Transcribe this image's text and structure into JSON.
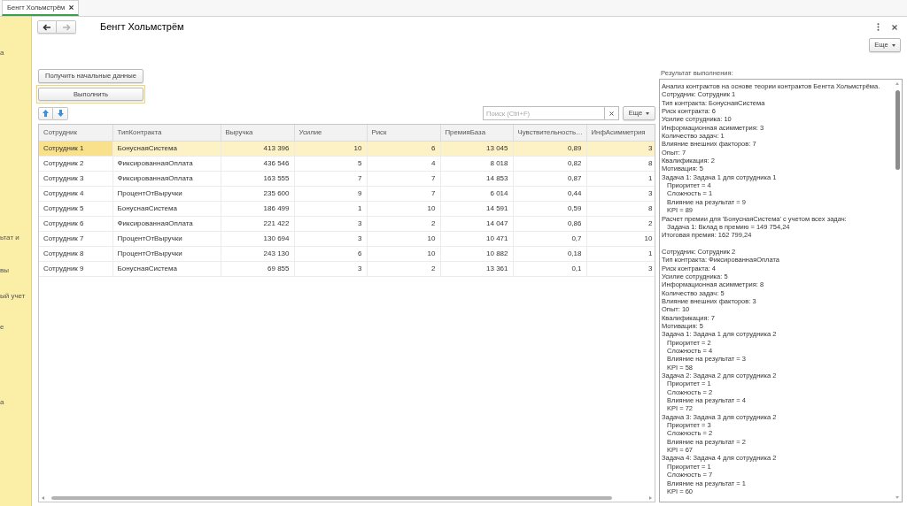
{
  "tab": {
    "title": "Бенгт Хольмстрём",
    "selected": true
  },
  "sidebar": {
    "items": [
      {
        "text": "а"
      },
      {
        "text": "ьтат и"
      },
      {
        "text": "вы"
      },
      {
        "text": "ый учет"
      },
      {
        "text": "е"
      },
      {
        "text": "а"
      }
    ]
  },
  "nav_buttons": [
    {
      "kind": "back",
      "disabled": false
    },
    {
      "kind": "forward",
      "disabled": true
    }
  ],
  "form": {
    "title": "Бенгт Хольмстрём",
    "more_button": "Еще"
  },
  "actions": [
    {
      "label": "Получить начальные данные",
      "focused": false
    },
    {
      "label": "Выполнить",
      "focused": true
    }
  ],
  "table_toolbar": {
    "search": {
      "placeholder": "Поиск (Ctrl+F)"
    },
    "more_button": "Еще"
  },
  "table": {
    "columns": [
      {
        "title": "Сотрудник",
        "kind": "text"
      },
      {
        "title": "ТипКонтракта",
        "kind": "text"
      },
      {
        "title": "Выручка",
        "kind": "number"
      },
      {
        "title": "Усилие",
        "kind": "number"
      },
      {
        "title": "Риск",
        "kind": "number"
      },
      {
        "title": "ПремияБаза",
        "kind": "number"
      },
      {
        "title": "Чувствительность…",
        "kind": "number"
      },
      {
        "title": "ИнфАсимметрия",
        "kind": "number"
      }
    ],
    "rows": [
      {
        "selected": true,
        "cells": [
          "Сотрудник 1",
          "БонуснаяСистема",
          "413 396",
          "10",
          "6",
          "13 045",
          "0,89",
          "3"
        ]
      },
      {
        "selected": false,
        "cells": [
          "Сотрудник 2",
          "ФиксированнаяОплата",
          "436 546",
          "5",
          "4",
          "8 018",
          "0,82",
          "8"
        ]
      },
      {
        "selected": false,
        "cells": [
          "Сотрудник 3",
          "ФиксированнаяОплата",
          "163 555",
          "7",
          "7",
          "14 853",
          "0,87",
          "1"
        ]
      },
      {
        "selected": false,
        "cells": [
          "Сотрудник 4",
          "ПроцентОтВыручки",
          "235 600",
          "9",
          "7",
          "6 014",
          "0,44",
          "3"
        ]
      },
      {
        "selected": false,
        "cells": [
          "Сотрудник 5",
          "БонуснаяСистема",
          "186 499",
          "1",
          "10",
          "14 591",
          "0,59",
          "8"
        ]
      },
      {
        "selected": false,
        "cells": [
          "Сотрудник 6",
          "ФиксированнаяОплата",
          "221 422",
          "3",
          "2",
          "14 047",
          "0,86",
          "2"
        ]
      },
      {
        "selected": false,
        "cells": [
          "Сотрудник 7",
          "ПроцентОтВыручки",
          "130 694",
          "3",
          "10",
          "10 471",
          "0,7",
          "10"
        ]
      },
      {
        "selected": false,
        "cells": [
          "Сотрудник 8",
          "ПроцентОтВыручки",
          "243 130",
          "6",
          "10",
          "10 882",
          "0,18",
          "1"
        ]
      },
      {
        "selected": false,
        "cells": [
          "Сотрудник 9",
          "БонуснаяСистема",
          "69 855",
          "3",
          "2",
          "13 361",
          "0,1",
          "3"
        ]
      }
    ]
  },
  "result": {
    "label": "Результат выполнения:",
    "blocks": [
      {
        "lines": [
          {
            "text": "Анализ контрактов на основе теории контрактов Бенгта Хольмстрёма."
          },
          {
            "text": "Сотрудник: Сотрудник 1"
          },
          {
            "text": "Тип контракта: БонуснаяСистема"
          },
          {
            "text": "Риск контракта: 6"
          },
          {
            "text": "Усилие сотрудника: 10"
          },
          {
            "text": "Информационная асимметрия: 3"
          },
          {
            "text": "Количество задач: 1"
          },
          {
            "text": "Влияние внешних факторов: 7"
          },
          {
            "text": "Опыт: 7"
          },
          {
            "text": "Квалификация: 2"
          },
          {
            "text": "Мотивация: 5"
          },
          {
            "text": "Задача 1: Задача 1 для сотрудника 1",
            "children": [
              "Приоритет = 4",
              "Сложность = 1",
              "Влияние на результат = 9",
              "KPI = 89"
            ]
          },
          {
            "text": "Расчет премии для 'БонуснаяСистема' с учетом всех задач:",
            "children": [
              "Задача 1: Вклад в премию = 149 754,24"
            ]
          },
          {
            "text": "Итоговая премия: 162 799,24"
          }
        ]
      },
      {
        "lines": [
          {
            "text": "Сотрудник: Сотрудник 2"
          },
          {
            "text": "Тип контракта: ФиксированнаяОплата"
          },
          {
            "text": "Риск контракта: 4"
          },
          {
            "text": "Усилие сотрудника: 5"
          },
          {
            "text": "Информационная асимметрия: 8"
          },
          {
            "text": "Количество задач: 5"
          },
          {
            "text": "Влияние внешних факторов: 3"
          },
          {
            "text": "Опыт: 10"
          },
          {
            "text": "Квалификация: 7"
          },
          {
            "text": "Мотивация: 5"
          },
          {
            "text": "Задача 1: Задача 1 для сотрудника 2",
            "children": [
              "Приоритет = 2",
              "Сложность = 4",
              "Влияние на результат = 3",
              "KPI = 58"
            ]
          },
          {
            "text": "Задача 2: Задача 2 для сотрудника 2",
            "children": [
              "Приоритет = 1",
              "Сложность = 2",
              "Влияние на результат = 4",
              "KPI = 72"
            ]
          },
          {
            "text": "Задача 3: Задача 3 для сотрудника 2",
            "children": [
              "Приоритет = 3",
              "Сложность = 2",
              "Влияние на результат = 2",
              "KPI = 67"
            ]
          },
          {
            "text": "Задача 4: Задача 4 для сотрудника 2",
            "children": [
              "Приоритет = 1",
              "Сложность = 7",
              "Влияние на результат = 1",
              "KPI = 60"
            ]
          }
        ]
      }
    ]
  }
}
